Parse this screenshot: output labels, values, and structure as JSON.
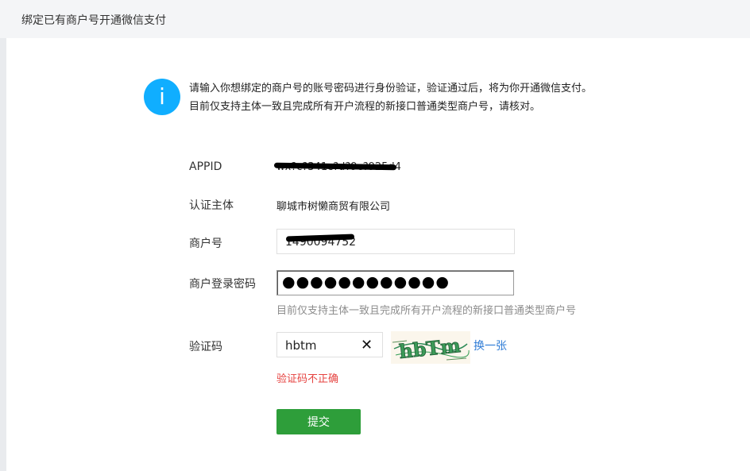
{
  "header": {
    "title": "绑定已有商户号开通微信支付"
  },
  "notice": {
    "icon": "info-icon",
    "line1": "请输入你想绑定的商户号的账号密码进行身份验证，验证通过后，将为你开通微信支付。",
    "line2": "目前仅支持主体一致且完成所有开户流程的新接口普通类型商户号，请核对。"
  },
  "form": {
    "appid": {
      "label": "APPID",
      "value": "wx?c?341c?d?9c?925d4"
    },
    "entity": {
      "label": "认证主体",
      "value": "聊城市树懒商贸有限公司"
    },
    "merchant": {
      "label": "商户号",
      "value": "1490094752"
    },
    "password": {
      "label": "商户登录密码",
      "masked": "●●●●●●●●●●●●",
      "hint": "目前仅支持主体一致且完成所有开户流程的新接口普通类型商户号"
    },
    "captcha": {
      "label": "验证码",
      "value": "hbtm",
      "clear_icon": "close-icon",
      "image_text": "hbTm",
      "refresh_label": "换一张",
      "error": "验证码不正确"
    },
    "submit_label": "提交"
  },
  "colors": {
    "accent_blue": "#10aeff",
    "link_blue": "#2f7cd6",
    "error_red": "#e64340",
    "submit_green": "#2e9e3a"
  }
}
